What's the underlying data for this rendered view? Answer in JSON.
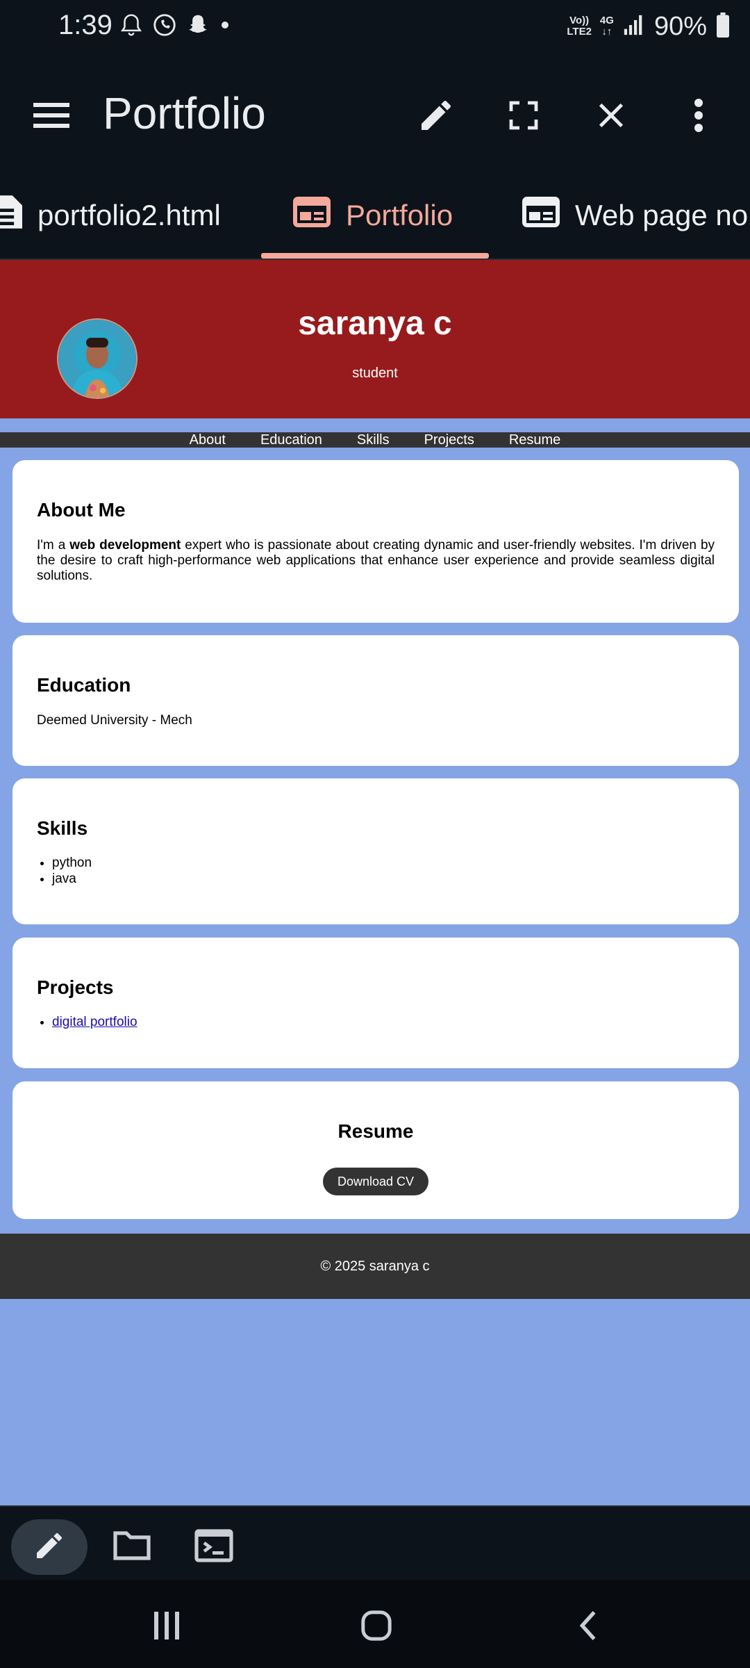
{
  "status_bar": {
    "time": "1:39",
    "network_top": "Vo))",
    "network_bottom": "LTE2",
    "data_type": "4G",
    "battery": "90%"
  },
  "app_bar": {
    "title": "Portfolio"
  },
  "tabs": [
    {
      "label": "portfolio2.html",
      "icon": "document-icon",
      "active": false
    },
    {
      "label": "Portfolio",
      "icon": "webpage-icon",
      "active": true
    },
    {
      "label": "Web page no..",
      "icon": "webpage-icon",
      "active": false
    }
  ],
  "page": {
    "hero": {
      "name": "saranya c",
      "role": "student"
    },
    "nav": [
      "About",
      "Education",
      "Skills",
      "Projects",
      "Resume"
    ],
    "about": {
      "heading": "About Me",
      "text_pre": "I'm a ",
      "text_bold": "web development",
      "text_post": " expert who is passionate about creating dynamic and user-friendly websites. I'm driven by the desire to craft high-performance web applications that enhance user experience and provide seamless digital solutions."
    },
    "education": {
      "heading": "Education",
      "text": "Deemed University - Mech"
    },
    "skills": {
      "heading": "Skills",
      "items": [
        "python",
        "java"
      ]
    },
    "projects": {
      "heading": "Projects",
      "items": [
        "digital portfolio"
      ]
    },
    "resume": {
      "heading": "Resume",
      "button": "Download CV"
    },
    "footer": "© 2025 saranya c"
  },
  "colors": {
    "hero_bg": "#971b1c",
    "page_bg": "#85a4e6",
    "nav_bg": "#333333",
    "tab_accent": "#f4a99a"
  }
}
